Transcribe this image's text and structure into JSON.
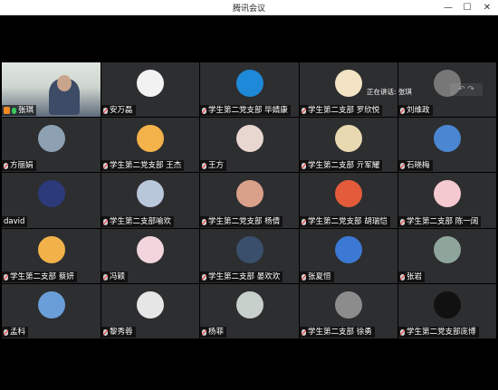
{
  "window": {
    "title": "腾讯会议",
    "controls": {
      "minimize": "—",
      "maximize": "☐",
      "close": "✕"
    }
  },
  "speaking": {
    "text": "正在讲话: 张琪"
  },
  "nav_arrows": "↶ ↷",
  "participants": [
    {
      "name": "张琪",
      "video": true,
      "mic": "on",
      "avatar": "video"
    },
    {
      "name": "安万磊",
      "mic": "off",
      "avatar": "batman",
      "color": "#f2f2f2"
    },
    {
      "name": "学生第二党支部 毕婧康",
      "mic": "off",
      "avatar": "patrick",
      "color": "#1d89d8"
    },
    {
      "name": "学生第二支部 罗欣悦",
      "mic": "off",
      "avatar": "anime-girl",
      "color": "#f3e3c5"
    },
    {
      "name": "刘维政",
      "mic": "off",
      "avatar": "photo",
      "color": "#777777"
    },
    {
      "name": "方丽娟",
      "mic": "off",
      "avatar": "landscape",
      "color": "#8da1b2"
    },
    {
      "name": "学生第二党支部 王杰",
      "mic": "off",
      "avatar": "cartoon",
      "color": "#f4b24a"
    },
    {
      "name": "王方",
      "mic": "off",
      "avatar": "flowers",
      "color": "#e8d6d0"
    },
    {
      "name": "学生第二支部 亓军耀",
      "mic": "off",
      "avatar": "cartoon",
      "color": "#e8d9b0"
    },
    {
      "name": "石晓梅",
      "mic": "off",
      "avatar": "dandelion",
      "color": "#4a86d1"
    },
    {
      "name": "david",
      "mic": "none",
      "avatar": "photo",
      "color": "#2d3a7a"
    },
    {
      "name": "学生第二支部喻欢",
      "mic": "off",
      "avatar": "anime",
      "color": "#b8c7d9"
    },
    {
      "name": "学生第二党支部 杨倩",
      "mic": "off",
      "avatar": "girl",
      "color": "#d9a08a"
    },
    {
      "name": "学生第二党支部 胡瑞恺",
      "mic": "off",
      "avatar": "cartoon",
      "color": "#e35b3b"
    },
    {
      "name": "学生第二支部 陈一阔",
      "mic": "off",
      "avatar": "cute",
      "color": "#f5c9d0"
    },
    {
      "name": "学生第二支部 蔡妍",
      "mic": "off",
      "avatar": "girl",
      "color": "#f2b24a"
    },
    {
      "name": "冯颖",
      "mic": "off",
      "avatar": "rabbit",
      "color": "#f2d5dc"
    },
    {
      "name": "学生第二支部 晏欢欢",
      "mic": "off",
      "avatar": "night",
      "color": "#3a4f6b"
    },
    {
      "name": "张夏恒",
      "mic": "off",
      "avatar": "sky",
      "color": "#3c79d4"
    },
    {
      "name": "张岩",
      "mic": "off",
      "avatar": "lake",
      "color": "#8ea59b"
    },
    {
      "name": "孟科",
      "mic": "off",
      "avatar": "sky",
      "color": "#6a9ed8"
    },
    {
      "name": "黎秀蓉",
      "mic": "off",
      "avatar": "default",
      "color": "#e6e6e6"
    },
    {
      "name": "杨菲",
      "mic": "off",
      "avatar": "landscape",
      "color": "#c8d0cc"
    },
    {
      "name": "学生第二支部 徐勇",
      "mic": "off",
      "avatar": "cartoon",
      "color": "#8c8c8c"
    },
    {
      "name": "学生第二党支部庞博",
      "mic": "off",
      "avatar": "bw",
      "color": "#111111"
    }
  ]
}
